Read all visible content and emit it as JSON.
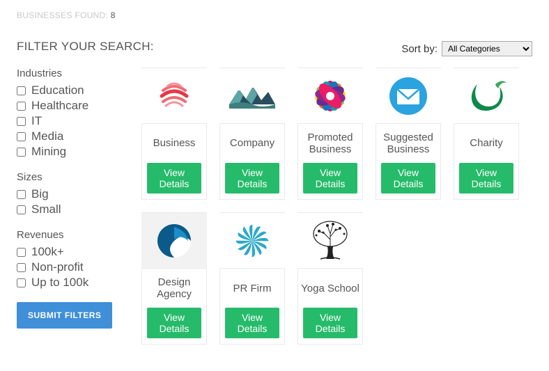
{
  "found": {
    "label": "BUSINESSES FOUND:",
    "count": "8"
  },
  "filter_heading": "FILTER YOUR SEARCH:",
  "sort": {
    "label": "Sort by:",
    "selected": "All Categories"
  },
  "filters": {
    "industries": {
      "title": "Industries",
      "items": [
        "Education",
        "Healthcare",
        "IT",
        "Media",
        "Mining"
      ]
    },
    "sizes": {
      "title": "Sizes",
      "items": [
        "Big",
        "Small"
      ]
    },
    "revenues": {
      "title": "Revenues",
      "items": [
        "100k+",
        "Non-profit",
        "Up to 100k"
      ]
    }
  },
  "submit_label": "SUBMIT FILTERS",
  "view_label": "View Details",
  "businesses": [
    {
      "name": "Business",
      "icon": "globe-red"
    },
    {
      "name": "Company",
      "icon": "mountains"
    },
    {
      "name": "Promoted Business",
      "icon": "rainbow-flower"
    },
    {
      "name": "Suggested Business",
      "icon": "mail-blue"
    },
    {
      "name": "Charity",
      "icon": "green-leaf"
    },
    {
      "name": "Design Agency",
      "icon": "blue-wave"
    },
    {
      "name": "PR Firm",
      "icon": "teal-spiral"
    },
    {
      "name": "Yoga School",
      "icon": "tree"
    }
  ]
}
